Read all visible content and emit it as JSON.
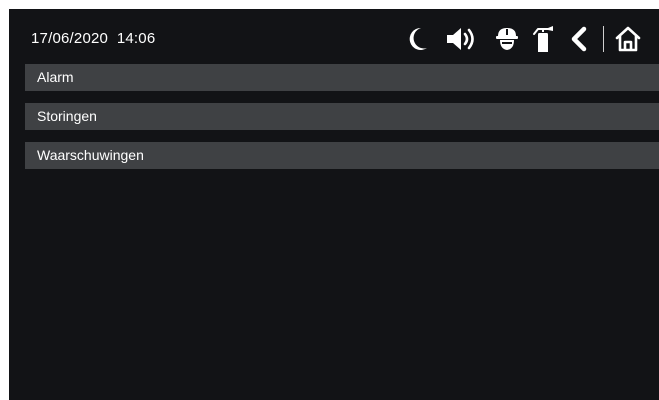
{
  "header": {
    "date": "17/06/2020",
    "time": "14:06",
    "icons": [
      "moon-icon",
      "speaker-icon",
      "firefighter-helmet-icon",
      "fire-extinguisher-icon",
      "back-chevron-icon",
      "home-icon"
    ]
  },
  "menu": {
    "items": [
      {
        "label": "Alarm"
      },
      {
        "label": "Storingen"
      },
      {
        "label": "Waarschuwingen"
      }
    ]
  },
  "colors": {
    "background": "#121316",
    "row": "#3f4144",
    "text": "#ffffff"
  }
}
